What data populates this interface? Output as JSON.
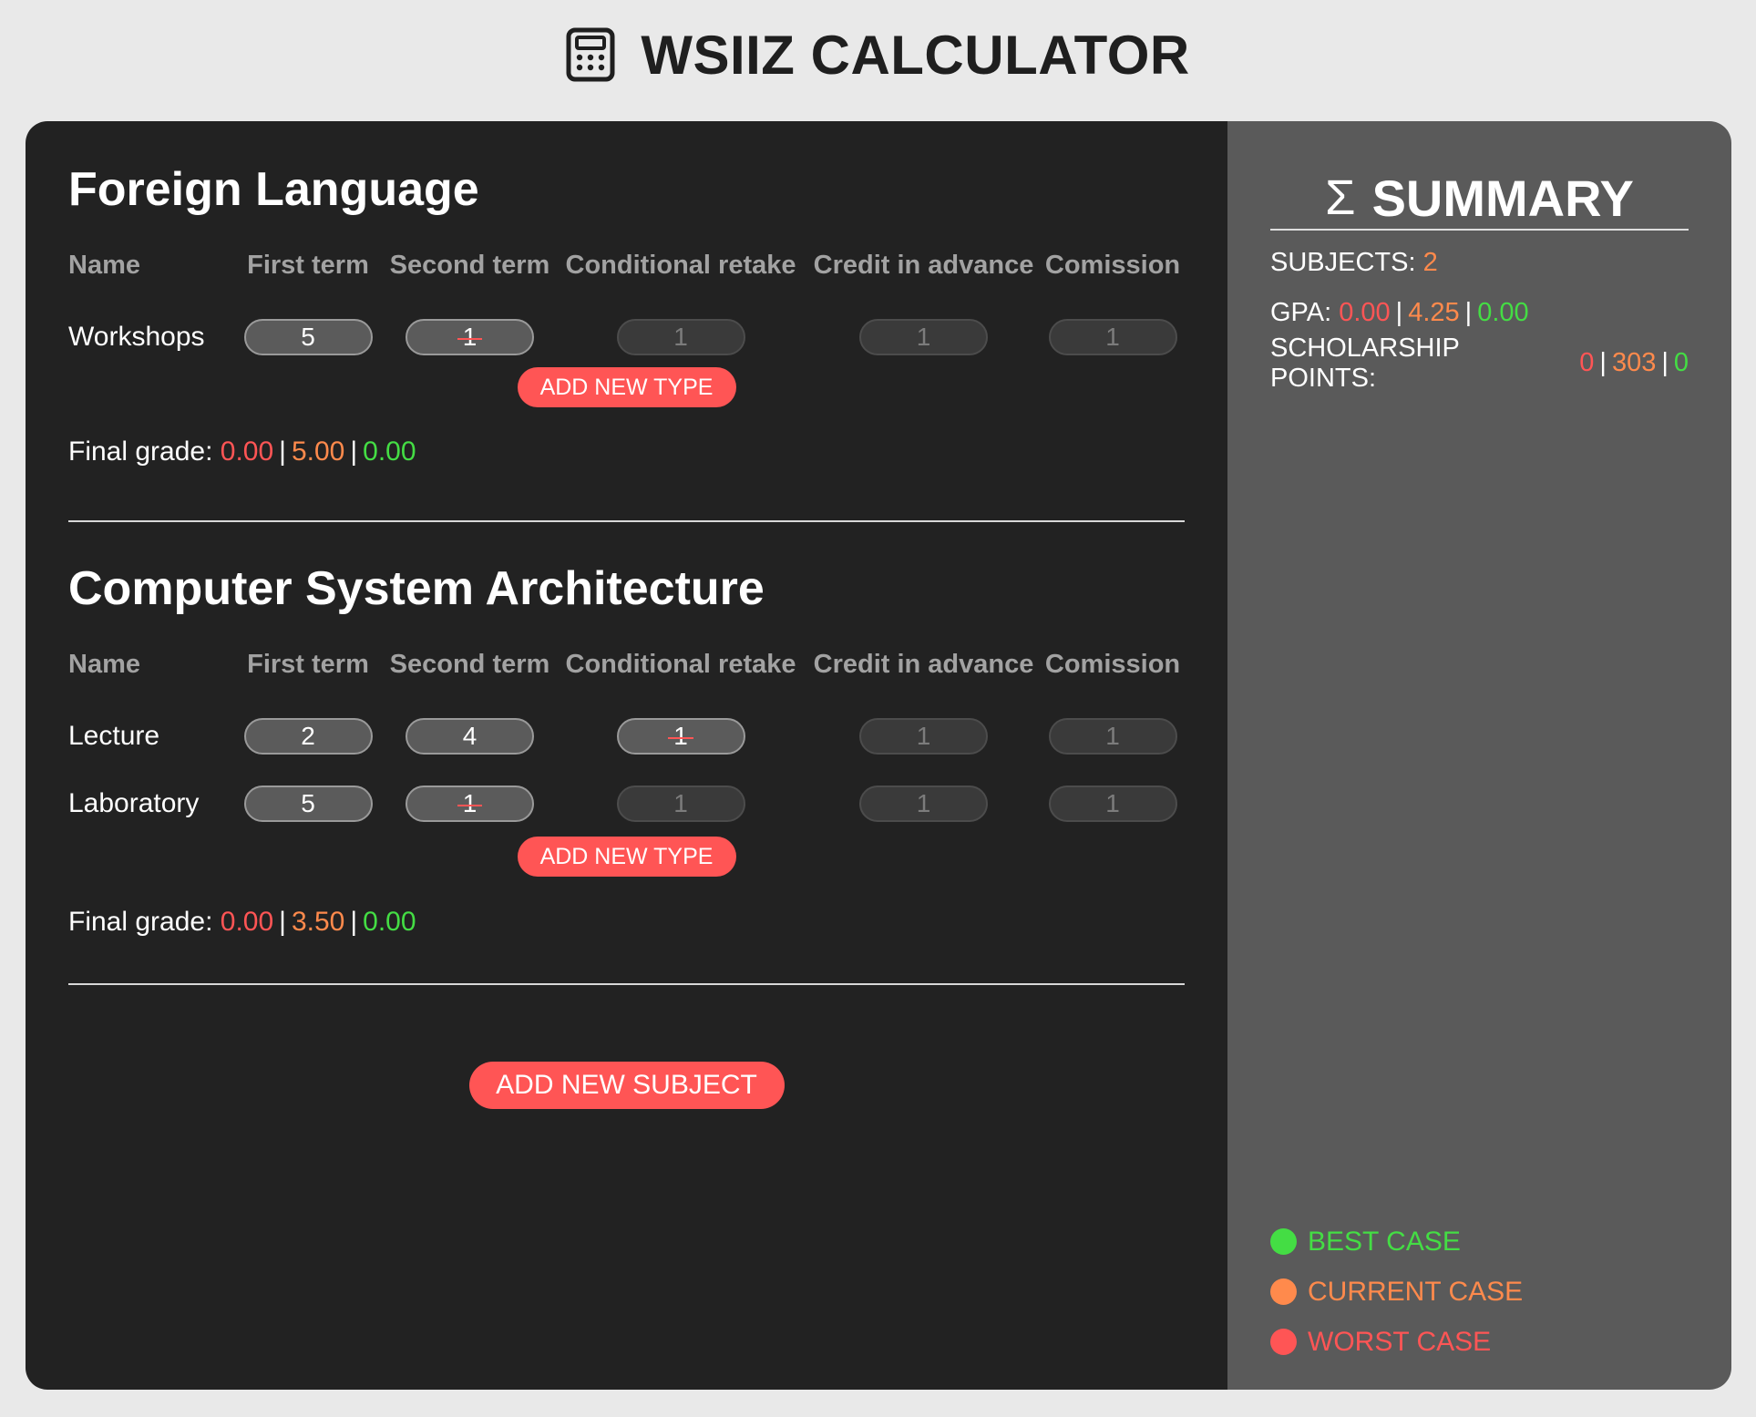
{
  "header": {
    "title": "WSIIZ CALCULATOR",
    "icon": "calculator-icon"
  },
  "columns": [
    "Name",
    "First term",
    "Second term",
    "Conditional retake",
    "Credit in advance",
    "Comission"
  ],
  "subjects": [
    {
      "title": "Foreign Language",
      "rows": [
        {
          "name": "Workshops",
          "first": "5",
          "second": "1",
          "retake": "1",
          "advance": "1",
          "commission": "1"
        }
      ],
      "add_type_label": "ADD NEW TYPE",
      "final_label": "Final grade:",
      "final": {
        "worst": "0.00",
        "current": "5.00",
        "best": "0.00"
      }
    },
    {
      "title": "Computer System Architecture",
      "rows": [
        {
          "name": "Lecture",
          "first": "2",
          "second": "4",
          "retake": "1",
          "advance": "1",
          "commission": "1"
        },
        {
          "name": "Laboratory",
          "first": "5",
          "second": "1",
          "retake": "1",
          "advance": "1",
          "commission": "1"
        }
      ],
      "add_type_label": "ADD NEW TYPE",
      "final_label": "Final grade:",
      "final": {
        "worst": "0.00",
        "current": "3.50",
        "best": "0.00"
      }
    }
  ],
  "add_subject_label": "ADD NEW SUBJECT",
  "summary": {
    "sigma": "Σ",
    "title": "SUMMARY",
    "subjects_label": "SUBJECTS:",
    "subjects_value": "2",
    "gpa_label": "GPA:",
    "gpa": {
      "worst": "0.00",
      "current": "4.25",
      "best": "0.00"
    },
    "points_label": "SCHOLARSHIP POINTS:",
    "points": {
      "worst": "0",
      "current": "303",
      "best": "0"
    },
    "separator": "|"
  },
  "legend": [
    {
      "label": "BEST CASE",
      "color": "#44dd44"
    },
    {
      "label": "CURRENT CASE",
      "color": "#ff8a4c"
    },
    {
      "label": "WORST CASE",
      "color": "#ff5555"
    }
  ]
}
